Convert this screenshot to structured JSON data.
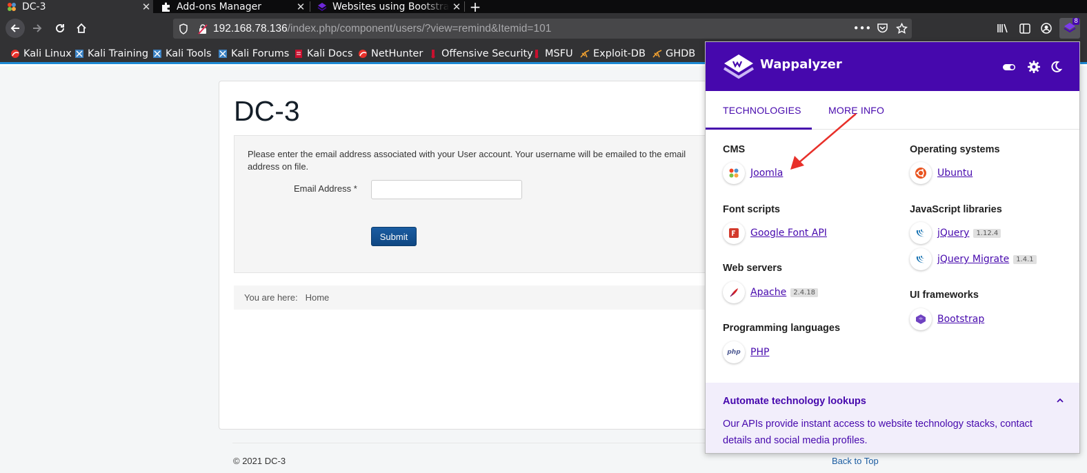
{
  "tabs": [
    {
      "title": "DC-3",
      "active": true
    },
    {
      "title": "Add-ons Manager",
      "active": false
    },
    {
      "title": "Websites using Bootstrap",
      "active": false
    }
  ],
  "url": {
    "host": "192.168.78.136",
    "path": "/index.php/component/users/?view=remind&Itemid=101"
  },
  "extension_badge": "8",
  "bookmarks": [
    "Kali Linux",
    "Kali Training",
    "Kali Tools",
    "Kali Forums",
    "Kali Docs",
    "NetHunter",
    "Offensive Security",
    "MSFU",
    "Exploit-DB",
    "GHDB"
  ],
  "page": {
    "site_title": "DC-3",
    "intro": "Please enter the email address associated with your User account. Your username will be emailed to the email address on file.",
    "email_label": "Email Address *",
    "email_value": "",
    "submit_label": "Submit",
    "breadcrumb_prefix": "You are here:",
    "breadcrumb_home": "Home",
    "copyright": "© 2021 DC-3",
    "back_to_top": "Back to Top"
  },
  "wappalyzer": {
    "brand": "Wappalyzer",
    "tabs": [
      "TECHNOLOGIES",
      "MORE INFO"
    ],
    "categories": {
      "cms": {
        "name": "CMS",
        "items": [
          {
            "name": "Joomla",
            "version": ""
          }
        ]
      },
      "font_scripts": {
        "name": "Font scripts",
        "items": [
          {
            "name": "Google Font API",
            "version": ""
          }
        ]
      },
      "web_servers": {
        "name": "Web servers",
        "items": [
          {
            "name": "Apache",
            "version": "2.4.18"
          }
        ]
      },
      "programming_languages": {
        "name": "Programming languages",
        "items": [
          {
            "name": "PHP",
            "version": ""
          }
        ]
      },
      "operating_systems": {
        "name": "Operating systems",
        "items": [
          {
            "name": "Ubuntu",
            "version": ""
          }
        ]
      },
      "javascript_libraries": {
        "name": "JavaScript libraries",
        "items": [
          {
            "name": "jQuery",
            "version": "1.12.4"
          },
          {
            "name": "jQuery Migrate",
            "version": "1.4.1"
          }
        ]
      },
      "ui_frameworks": {
        "name": "UI frameworks",
        "items": [
          {
            "name": "Bootstrap",
            "version": ""
          }
        ]
      }
    },
    "footer": {
      "title": "Automate technology lookups",
      "text": "Our APIs provide instant access to website technology stacks, contact details and social media profiles."
    }
  },
  "colors": {
    "wappalyzer_purple": "#4608ad",
    "joomla_blue": "#1a5ca1",
    "annotation_red": "#e8302a"
  }
}
